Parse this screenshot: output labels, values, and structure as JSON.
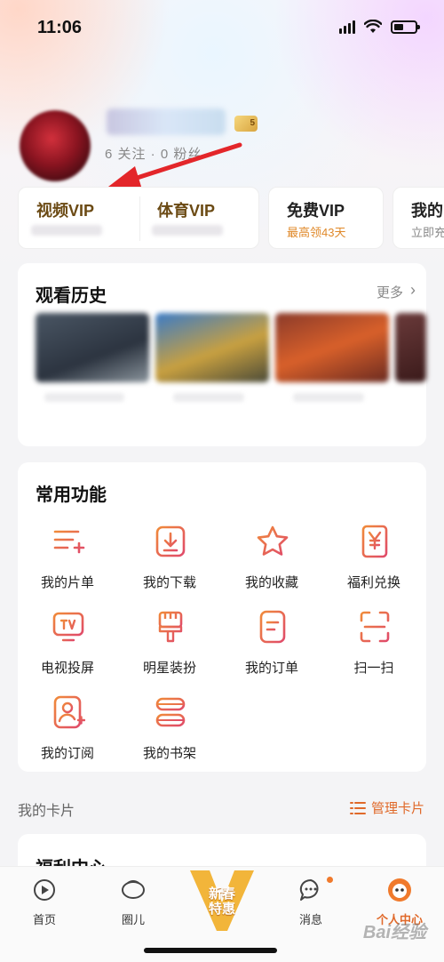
{
  "status_bar": {
    "time": "11:06"
  },
  "profile": {
    "level_badge": "5",
    "follow_text": "6 关注 · 0 粉丝"
  },
  "vip_cards": [
    {
      "title": "视频VIP"
    },
    {
      "title": "体育VIP"
    },
    {
      "title": "免费VIP",
      "subtitle": "最高领43天"
    },
    {
      "title": "我的",
      "subtitle": "立即充"
    }
  ],
  "history": {
    "title": "观看历史",
    "more": "更多"
  },
  "functions": {
    "title": "常用功能",
    "items": [
      {
        "label": "我的片单",
        "icon": "playlist-icon"
      },
      {
        "label": "我的下载",
        "icon": "download-icon"
      },
      {
        "label": "我的收藏",
        "icon": "star-icon"
      },
      {
        "label": "福利兑换",
        "icon": "yen-icon"
      },
      {
        "label": "电视投屏",
        "icon": "tv-icon"
      },
      {
        "label": "明星装扮",
        "icon": "brush-icon"
      },
      {
        "label": "我的订单",
        "icon": "order-icon"
      },
      {
        "label": "扫一扫",
        "icon": "scan-icon"
      },
      {
        "label": "我的订阅",
        "icon": "subscribe-icon"
      },
      {
        "label": "我的书架",
        "icon": "bookshelf-icon"
      }
    ]
  },
  "my_cards": {
    "label": "我的卡片",
    "manage": "管理卡片"
  },
  "welfare": {
    "title": "福利中心"
  },
  "tabbar": {
    "items": [
      {
        "label": "首页"
      },
      {
        "label": "圈儿"
      },
      {
        "label": "消息"
      },
      {
        "label": "个人中心"
      }
    ],
    "promo_line1": "新春",
    "promo_line2": "特惠"
  },
  "watermark": "Bai经验",
  "colors": {
    "accent": "#e0692a",
    "vip_gold": "#6b4a14",
    "annotation_red": "#e3262a"
  }
}
